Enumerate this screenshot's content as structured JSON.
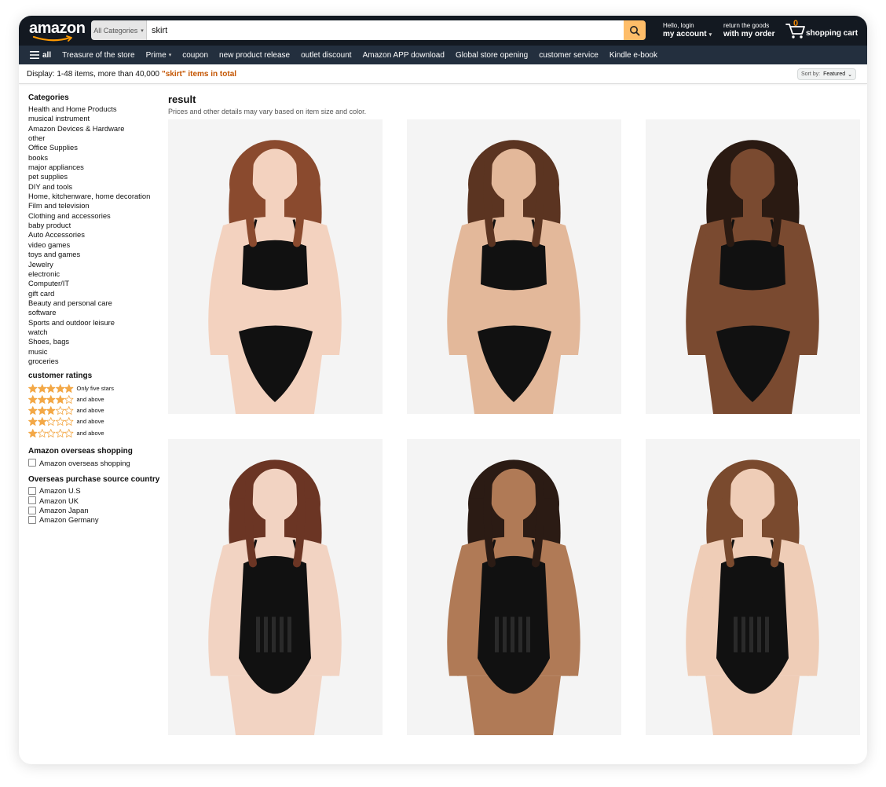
{
  "header": {
    "logo": "amazon",
    "search": {
      "category": "All Categories",
      "query": "skirt"
    },
    "account": {
      "greeting": "Hello, login",
      "label": "my account"
    },
    "orders": {
      "line1": "return the goods",
      "line2": "with my order"
    },
    "cart": {
      "count": "0",
      "label": "shopping cart"
    }
  },
  "subnav": {
    "all": "all",
    "items": [
      "Treasure of the store",
      "Prime",
      "coupon",
      "new product release",
      "outlet discount",
      "Amazon APP download",
      "Global store opening",
      "customer service",
      "Kindle e-book"
    ]
  },
  "resultbar": {
    "prefix": "Display: 1-48 items, more than 40,000 ",
    "query": "\"skirt\" items in total",
    "sort_label": "Sort by:",
    "sort_value": "Featured"
  },
  "sidebar": {
    "categories_heading": "Categories",
    "categories": [
      "Health and Home Products",
      "musical instrument",
      "Amazon Devices & Hardware",
      "other",
      "Office Supplies",
      "books",
      "major appliances",
      "pet supplies",
      "DIY and tools",
      "Home, kitchenware, home decoration",
      "Film and television",
      "Clothing and accessories",
      "baby product",
      "Auto Accessories",
      "video games",
      "toys and games",
      "Jewelry",
      "electronic",
      "Computer/IT",
      "gift card",
      "Beauty and personal care",
      "software",
      "Sports and outdoor leisure",
      "watch",
      "Shoes, bags",
      "music",
      "groceries"
    ],
    "ratings_heading": "customer ratings",
    "ratings": [
      {
        "stars": 5,
        "label": "Only five stars"
      },
      {
        "stars": 4,
        "label": "and above"
      },
      {
        "stars": 3,
        "label": "and above"
      },
      {
        "stars": 2,
        "label": "and above"
      },
      {
        "stars": 1,
        "label": "and above"
      }
    ],
    "overseas_heading": "Amazon overseas shopping",
    "overseas_option": "Amazon overseas shopping",
    "source_heading": "Overseas purchase source country",
    "source_options": [
      "Amazon U.S",
      "Amazon UK",
      "Amazon Japan",
      "Amazon Germany"
    ]
  },
  "main": {
    "title": "result",
    "subtitle": "Prices and other details may vary based on item size and color."
  },
  "products": [
    {
      "hair": "#8a4a2e",
      "skin": "#f3d2bf",
      "garment": "bikini"
    },
    {
      "hair": "#5b3421",
      "skin": "#e3b89a",
      "garment": "bikini"
    },
    {
      "hair": "#2a1a12",
      "skin": "#7a4a30",
      "garment": "bikini-back"
    },
    {
      "hair": "#6b3524",
      "skin": "#f2d3c2",
      "garment": "onepiece"
    },
    {
      "hair": "#2b1b14",
      "skin": "#b07a56",
      "garment": "onepiece"
    },
    {
      "hair": "#7a4a2e",
      "skin": "#efcdb7",
      "garment": "onepiece"
    }
  ],
  "colors": {
    "nav_bg": "#131921",
    "subnav_bg": "#232f3e",
    "search_button": "#febd69",
    "query_highlight": "#c45500",
    "star": "#f3a847"
  }
}
